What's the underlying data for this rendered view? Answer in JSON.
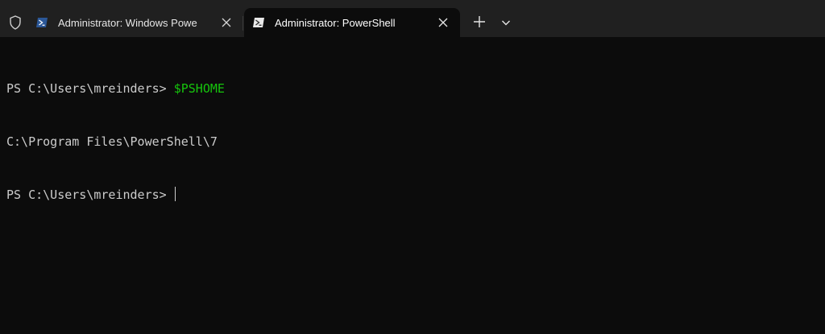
{
  "tabs": [
    {
      "label": "Administrator: Windows Powe",
      "active": false
    },
    {
      "label": "Administrator: PowerShell",
      "active": true
    }
  ],
  "icons": {
    "shield": "shield-icon",
    "powershell": "powershell-icon",
    "close": "close-icon",
    "new_tab": "plus-icon",
    "dropdown": "chevron-down-icon"
  },
  "colors": {
    "tabbar": "#202020",
    "terminal_bg": "#0c0c0c",
    "text": "#cccccc",
    "command": "#16c60c",
    "ps_icon_bg": "#2b5797"
  },
  "terminal": {
    "lines": [
      {
        "prompt": "PS C:\\Users\\mreinders> ",
        "command": "$PSHOME"
      },
      {
        "output": "C:\\Program Files\\PowerShell\\7"
      },
      {
        "prompt": "PS C:\\Users\\mreinders> ",
        "command": ""
      }
    ]
  }
}
